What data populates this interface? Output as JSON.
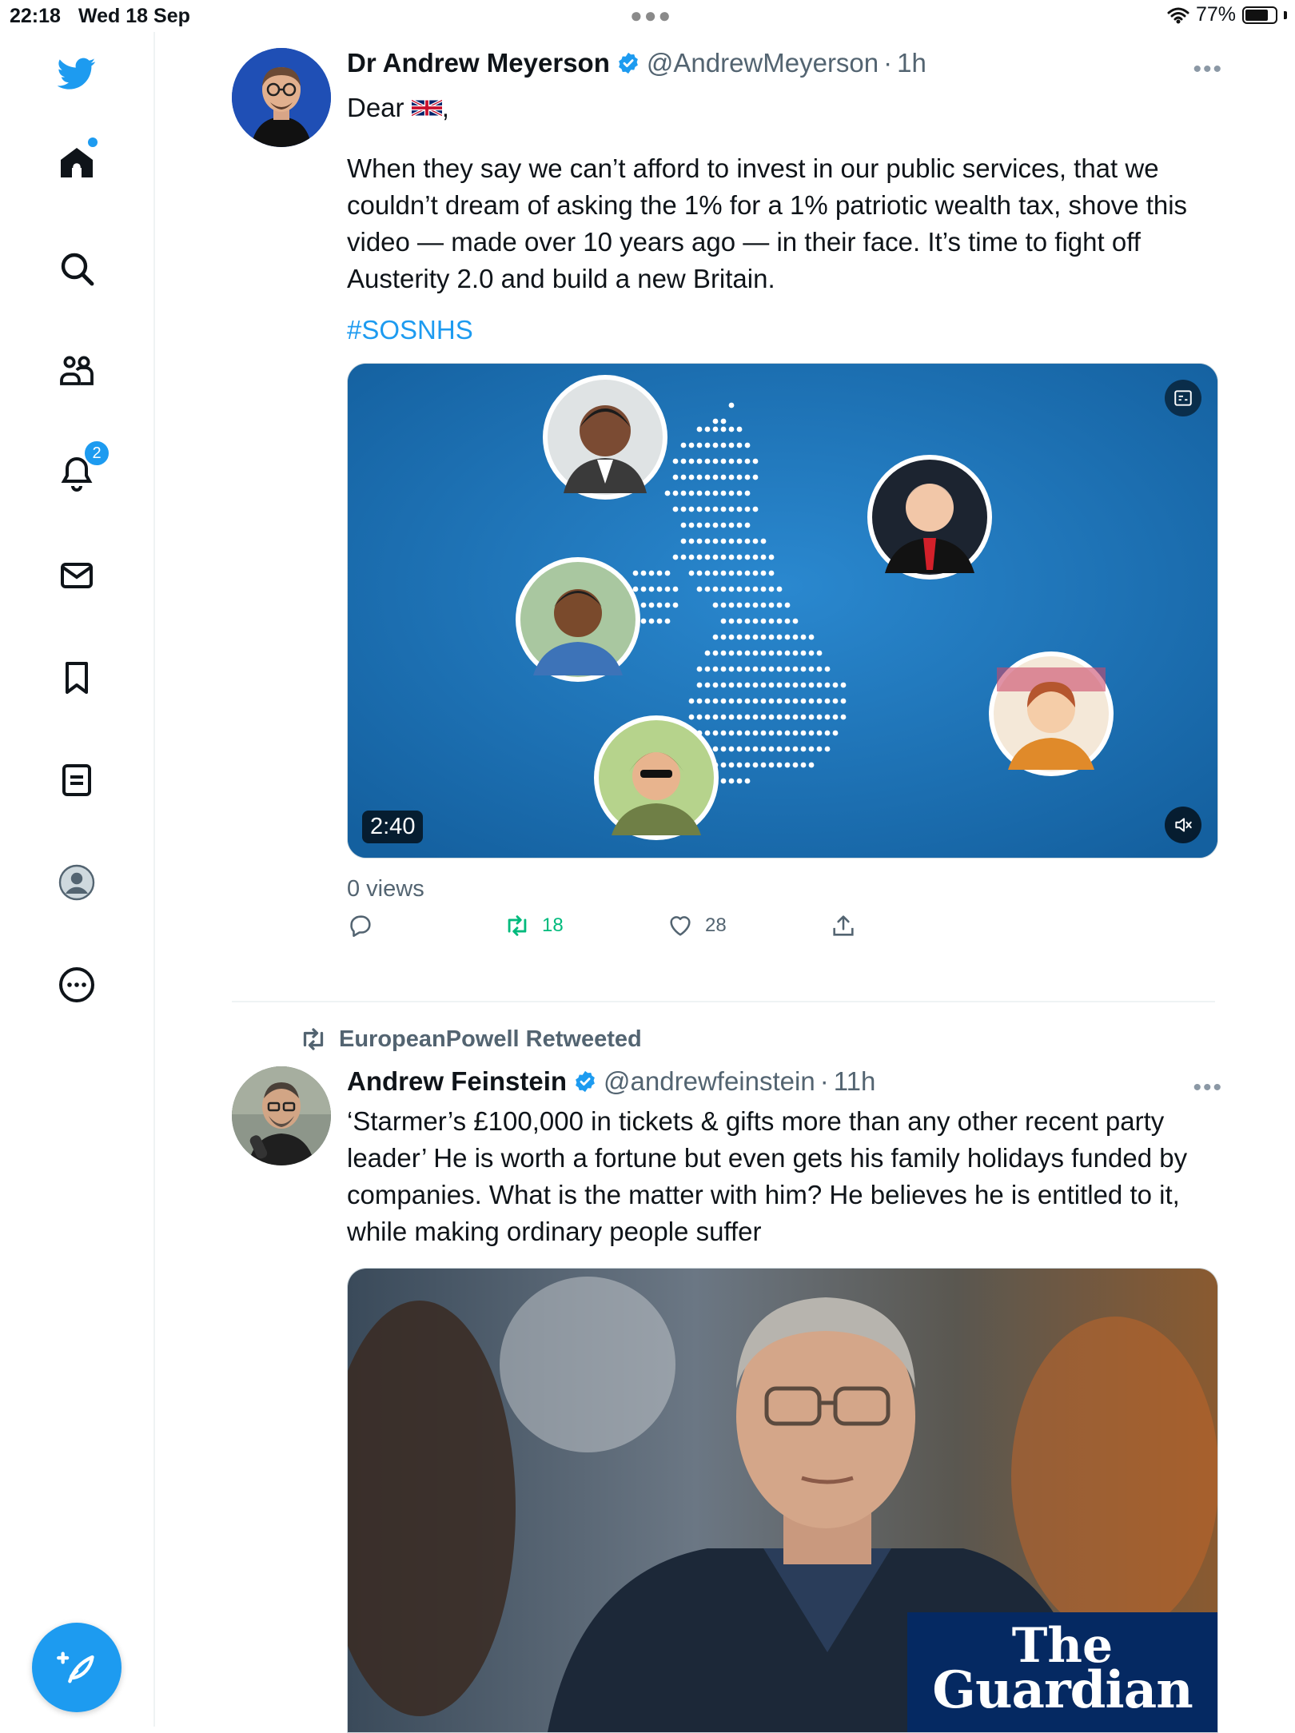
{
  "status_bar": {
    "time": "22:18",
    "date": "Wed 18 Sep",
    "battery": "77%",
    "battery_level": 0.77
  },
  "sidebar": {
    "items": [
      {
        "icon": "twitter-bird-icon"
      },
      {
        "icon": "home-icon",
        "has_dot": true
      },
      {
        "icon": "search-icon"
      },
      {
        "icon": "communities-icon"
      },
      {
        "icon": "notifications-icon",
        "badge": "2"
      },
      {
        "icon": "messages-icon"
      },
      {
        "icon": "bookmarks-icon"
      },
      {
        "icon": "lists-icon"
      },
      {
        "icon": "profile-icon"
      },
      {
        "icon": "more-icon"
      }
    ],
    "compose_icon": "compose-tweet-icon"
  },
  "tweets": [
    {
      "author": "Dr Andrew Meyerson",
      "handle": "@AndrewMeyerson",
      "sep": "·",
      "time": "1h",
      "greeting": "Dear",
      "greeting_suffix": ",",
      "text": "When they say we can’t afford to invest in our public services, that we couldn’t dream of asking the 1% for a 1% patriotic wealth tax, shove this video — made over 10 years ago — in their face. It’s time to fight off Austerity 2.0 and build a new Britain.",
      "hashtag": "#SOSNHS",
      "video_duration": "2:40",
      "views": "0 views",
      "retweets": "18",
      "likes": "28"
    },
    {
      "retweeted_by": "EuropeanPowell Retweeted",
      "author": "Andrew Feinstein",
      "handle": "@andrewfeinstein",
      "sep": "·",
      "time": "11h",
      "text": "‘Starmer’s £100,000 in tickets & gifts more than any other recent party leader’ He is worth a fortune but even gets his family holidays funded by companies. What is the matter with him? He believes he is entitled to it, while making ordinary people suffer",
      "image_brand_line1": "The",
      "image_brand_line2": "Guardian"
    }
  ],
  "colors": {
    "accent": "#1d9bf0",
    "retweet_green": "#00ba7c",
    "video_bg": "#1a6fb0",
    "guardian_blue": "#052962"
  }
}
